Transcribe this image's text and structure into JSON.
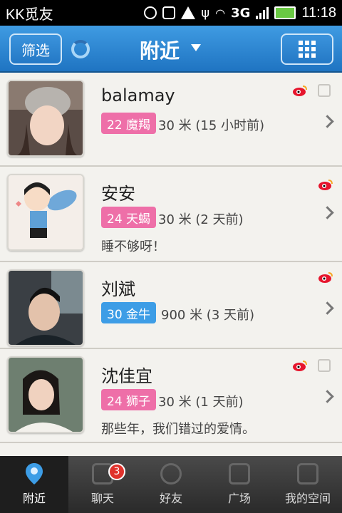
{
  "status_bar": {
    "app_name": "KK觅友",
    "time": "11:18",
    "network": "3G"
  },
  "header": {
    "filter_label": "筛选",
    "title": "附近"
  },
  "users": [
    {
      "name": "balamay",
      "age_sign": "22 魔羯",
      "distance": "30 米 (15 小时前)",
      "status": "",
      "badge_color": "#ee6fa8"
    },
    {
      "name": "安安",
      "age_sign": "24 天蝎",
      "distance": "30 米 (2 天前)",
      "status": "睡不够呀！",
      "badge_color": "#ee6fa8"
    },
    {
      "name": "刘斌",
      "age_sign": "30 金牛",
      "distance": "900 米 (3 天前)",
      "status": "",
      "badge_color": "#3d9de6"
    },
    {
      "name": "沈佳宜",
      "age_sign": "24 狮子",
      "distance": "30 米 (1 天前)",
      "status": "那些年，我们错过的爱情。",
      "badge_color": "#ee6fa8"
    }
  ],
  "tabs": [
    {
      "label": "附近",
      "icon": "location-pin-icon"
    },
    {
      "label": "聊天",
      "icon": "chat-icon",
      "badge": "3"
    },
    {
      "label": "好友",
      "icon": "friends-icon"
    },
    {
      "label": "广场",
      "icon": "plaza-icon"
    },
    {
      "label": "我的空间",
      "icon": "my-space-icon"
    }
  ]
}
